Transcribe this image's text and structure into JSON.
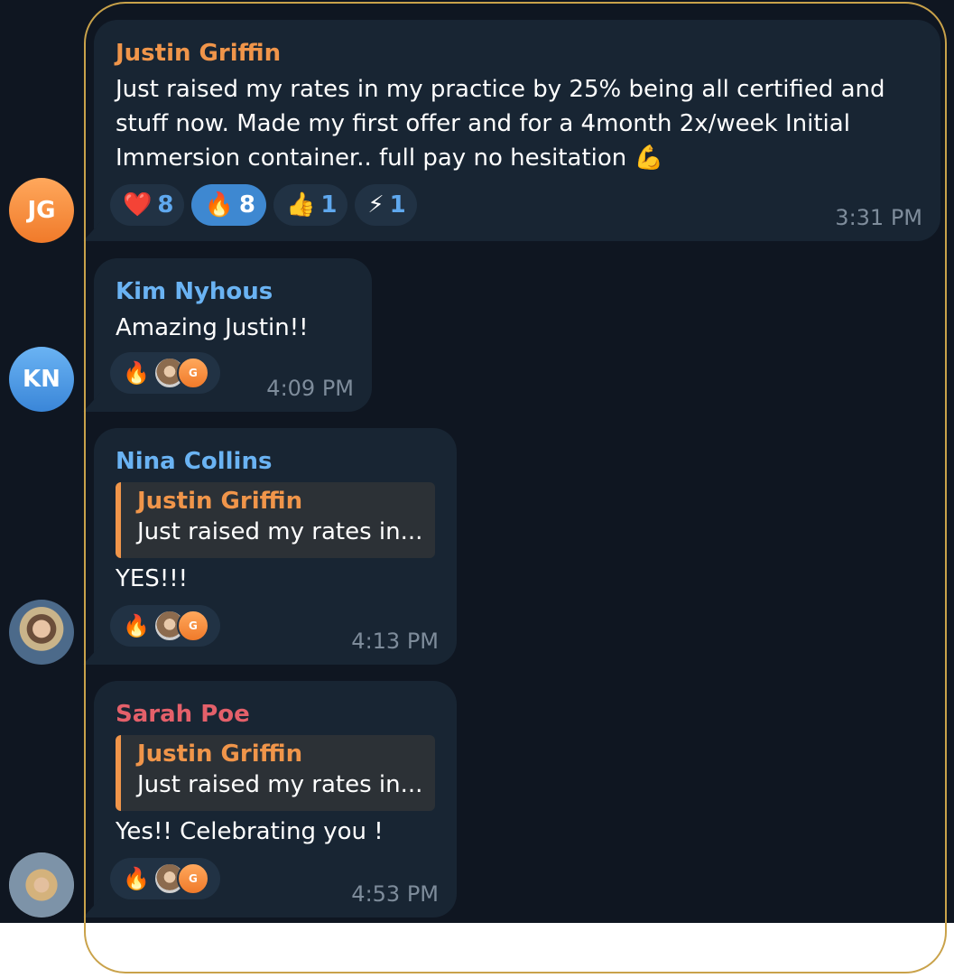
{
  "messages": [
    {
      "sender": "Justin Griffin",
      "sender_color": "#f0954a",
      "avatar_initials": "JG",
      "lines": [
        "Just raised my rates in my practice by 25% being all certified and",
        "stuff now. Made my first offer and for a 4month 2x/week Initial",
        "Immersion container.. full pay no hesitation 💪"
      ],
      "reactions": [
        {
          "emoji": "❤️",
          "count": "8",
          "active": false
        },
        {
          "emoji": "🔥",
          "count": "8",
          "active": true
        },
        {
          "emoji": "👍",
          "count": "1",
          "active": false
        },
        {
          "emoji": "⚡",
          "count": "1",
          "active": false
        }
      ],
      "time": "3:31 PM"
    },
    {
      "sender": "Kim Nyhous",
      "sender_color": "#6ab3f3",
      "avatar_initials": "KN",
      "text": "Amazing Justin!!",
      "reaction": {
        "emoji": "🔥",
        "reactor_initial": "G"
      },
      "time": "4:09 PM"
    },
    {
      "sender": "Nina Collins",
      "sender_color": "#6ab3f3",
      "avatar": "photo-avatar",
      "reply_to": {
        "name": "Justin Griffin",
        "text": "Just raised my rates in..."
      },
      "text": "YES!!!",
      "reaction": {
        "emoji": "🔥",
        "reactor_initial": "G"
      },
      "time": "4:13 PM"
    },
    {
      "sender": "Sarah Poe",
      "sender_color": "#e4606a",
      "avatar": "photo-avatar",
      "reply_to": {
        "name": "Justin Griffin",
        "text": "Just raised my rates in..."
      },
      "text": "Yes!! Celebrating you !",
      "reaction": {
        "emoji": "🔥",
        "reactor_initial": "G"
      },
      "time": "4:53 PM"
    }
  ],
  "colors": {
    "chat_background": "#0f1621",
    "bubble": "#182533",
    "frame": "#c9a24a",
    "timestamp": "#7e8c9b",
    "reaction_count": "#5fa8ee",
    "reaction_active": "#3e88d1"
  }
}
